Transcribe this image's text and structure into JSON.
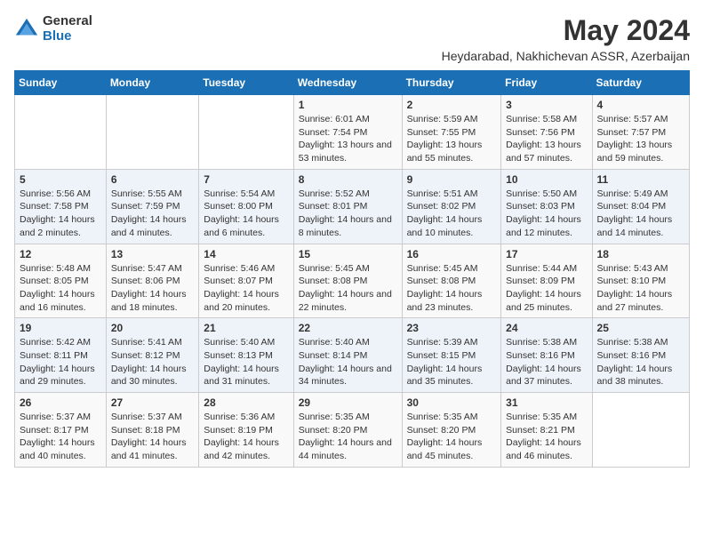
{
  "header": {
    "logo_general": "General",
    "logo_blue": "Blue",
    "title": "May 2024",
    "subtitle": "Heydarabad, Nakhichevan ASSR, Azerbaijan"
  },
  "days_of_week": [
    "Sunday",
    "Monday",
    "Tuesday",
    "Wednesday",
    "Thursday",
    "Friday",
    "Saturday"
  ],
  "weeks": [
    [
      {
        "day": "",
        "info": ""
      },
      {
        "day": "",
        "info": ""
      },
      {
        "day": "",
        "info": ""
      },
      {
        "day": "1",
        "info": "Sunrise: 6:01 AM\nSunset: 7:54 PM\nDaylight: 13 hours\nand 53 minutes."
      },
      {
        "day": "2",
        "info": "Sunrise: 5:59 AM\nSunset: 7:55 PM\nDaylight: 13 hours\nand 55 minutes."
      },
      {
        "day": "3",
        "info": "Sunrise: 5:58 AM\nSunset: 7:56 PM\nDaylight: 13 hours\nand 57 minutes."
      },
      {
        "day": "4",
        "info": "Sunrise: 5:57 AM\nSunset: 7:57 PM\nDaylight: 13 hours\nand 59 minutes."
      }
    ],
    [
      {
        "day": "5",
        "info": "Sunrise: 5:56 AM\nSunset: 7:58 PM\nDaylight: 14 hours\nand 2 minutes."
      },
      {
        "day": "6",
        "info": "Sunrise: 5:55 AM\nSunset: 7:59 PM\nDaylight: 14 hours\nand 4 minutes."
      },
      {
        "day": "7",
        "info": "Sunrise: 5:54 AM\nSunset: 8:00 PM\nDaylight: 14 hours\nand 6 minutes."
      },
      {
        "day": "8",
        "info": "Sunrise: 5:52 AM\nSunset: 8:01 PM\nDaylight: 14 hours\nand 8 minutes."
      },
      {
        "day": "9",
        "info": "Sunrise: 5:51 AM\nSunset: 8:02 PM\nDaylight: 14 hours\nand 10 minutes."
      },
      {
        "day": "10",
        "info": "Sunrise: 5:50 AM\nSunset: 8:03 PM\nDaylight: 14 hours\nand 12 minutes."
      },
      {
        "day": "11",
        "info": "Sunrise: 5:49 AM\nSunset: 8:04 PM\nDaylight: 14 hours\nand 14 minutes."
      }
    ],
    [
      {
        "day": "12",
        "info": "Sunrise: 5:48 AM\nSunset: 8:05 PM\nDaylight: 14 hours\nand 16 minutes."
      },
      {
        "day": "13",
        "info": "Sunrise: 5:47 AM\nSunset: 8:06 PM\nDaylight: 14 hours\nand 18 minutes."
      },
      {
        "day": "14",
        "info": "Sunrise: 5:46 AM\nSunset: 8:07 PM\nDaylight: 14 hours\nand 20 minutes."
      },
      {
        "day": "15",
        "info": "Sunrise: 5:45 AM\nSunset: 8:08 PM\nDaylight: 14 hours\nand 22 minutes."
      },
      {
        "day": "16",
        "info": "Sunrise: 5:45 AM\nSunset: 8:08 PM\nDaylight: 14 hours\nand 23 minutes."
      },
      {
        "day": "17",
        "info": "Sunrise: 5:44 AM\nSunset: 8:09 PM\nDaylight: 14 hours\nand 25 minutes."
      },
      {
        "day": "18",
        "info": "Sunrise: 5:43 AM\nSunset: 8:10 PM\nDaylight: 14 hours\nand 27 minutes."
      }
    ],
    [
      {
        "day": "19",
        "info": "Sunrise: 5:42 AM\nSunset: 8:11 PM\nDaylight: 14 hours\nand 29 minutes."
      },
      {
        "day": "20",
        "info": "Sunrise: 5:41 AM\nSunset: 8:12 PM\nDaylight: 14 hours\nand 30 minutes."
      },
      {
        "day": "21",
        "info": "Sunrise: 5:40 AM\nSunset: 8:13 PM\nDaylight: 14 hours\nand 31 minutes."
      },
      {
        "day": "22",
        "info": "Sunrise: 5:40 AM\nSunset: 8:14 PM\nDaylight: 14 hours\nand 34 minutes."
      },
      {
        "day": "23",
        "info": "Sunrise: 5:39 AM\nSunset: 8:15 PM\nDaylight: 14 hours\nand 35 minutes."
      },
      {
        "day": "24",
        "info": "Sunrise: 5:38 AM\nSunset: 8:16 PM\nDaylight: 14 hours\nand 37 minutes."
      },
      {
        "day": "25",
        "info": "Sunrise: 5:38 AM\nSunset: 8:16 PM\nDaylight: 14 hours\nand 38 minutes."
      }
    ],
    [
      {
        "day": "26",
        "info": "Sunrise: 5:37 AM\nSunset: 8:17 PM\nDaylight: 14 hours\nand 40 minutes."
      },
      {
        "day": "27",
        "info": "Sunrise: 5:37 AM\nSunset: 8:18 PM\nDaylight: 14 hours\nand 41 minutes."
      },
      {
        "day": "28",
        "info": "Sunrise: 5:36 AM\nSunset: 8:19 PM\nDaylight: 14 hours\nand 42 minutes."
      },
      {
        "day": "29",
        "info": "Sunrise: 5:35 AM\nSunset: 8:20 PM\nDaylight: 14 hours\nand 44 minutes."
      },
      {
        "day": "30",
        "info": "Sunrise: 5:35 AM\nSunset: 8:20 PM\nDaylight: 14 hours\nand 45 minutes."
      },
      {
        "day": "31",
        "info": "Sunrise: 5:35 AM\nSunset: 8:21 PM\nDaylight: 14 hours\nand 46 minutes."
      },
      {
        "day": "",
        "info": ""
      }
    ]
  ]
}
